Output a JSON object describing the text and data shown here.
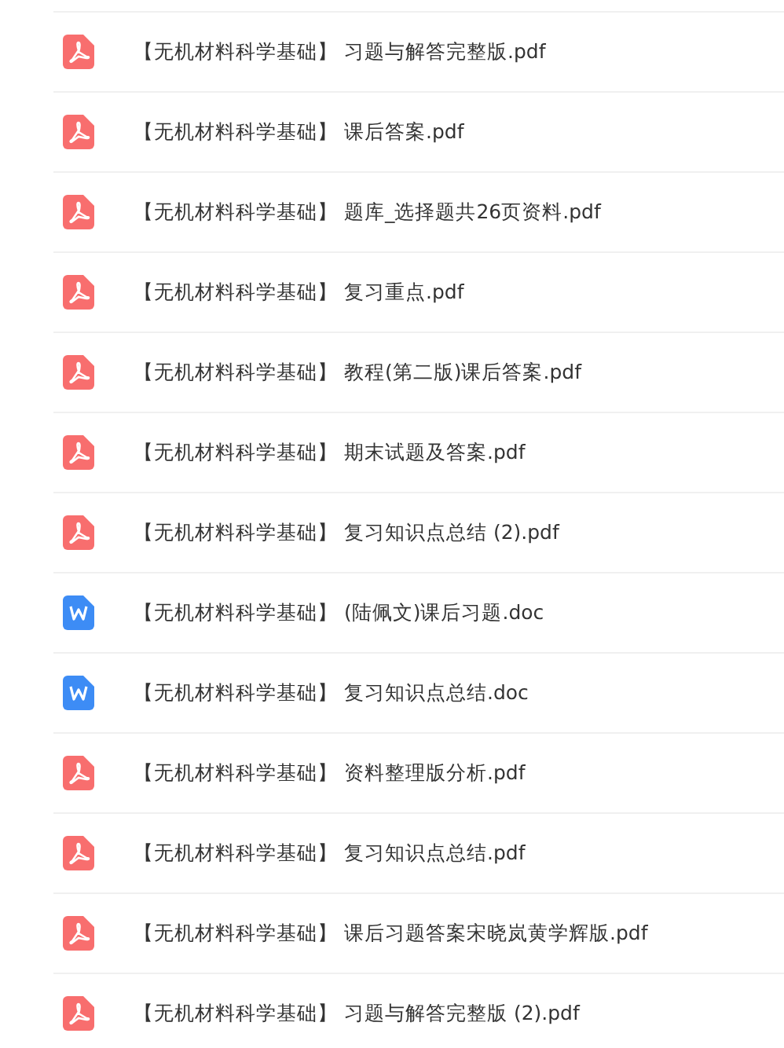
{
  "files": [
    {
      "kind": "pdf",
      "name": "【无机材料科学基础】 习题与解答完整版.pdf"
    },
    {
      "kind": "pdf",
      "name": "【无机材料科学基础】 课后答案.pdf"
    },
    {
      "kind": "pdf",
      "name": "【无机材料科学基础】 题库_选择题共26页资料.pdf"
    },
    {
      "kind": "pdf",
      "name": "【无机材料科学基础】 复习重点.pdf"
    },
    {
      "kind": "pdf",
      "name": "【无机材料科学基础】 教程(第二版)课后答案.pdf"
    },
    {
      "kind": "pdf",
      "name": "【无机材料科学基础】 期末试题及答案.pdf"
    },
    {
      "kind": "pdf",
      "name": "【无机材料科学基础】 复习知识点总结 (2).pdf"
    },
    {
      "kind": "doc",
      "name": "【无机材料科学基础】 (陆佩文)课后习题.doc"
    },
    {
      "kind": "doc",
      "name": "【无机材料科学基础】 复习知识点总结.doc"
    },
    {
      "kind": "pdf",
      "name": "【无机材料科学基础】 资料整理版分析.pdf"
    },
    {
      "kind": "pdf",
      "name": "【无机材料科学基础】 复习知识点总结.pdf"
    },
    {
      "kind": "pdf",
      "name": "【无机材料科学基础】 课后习题答案宋晓岚黄学辉版.pdf"
    },
    {
      "kind": "pdf",
      "name": "【无机材料科学基础】 习题与解答完整版 (2).pdf"
    }
  ]
}
